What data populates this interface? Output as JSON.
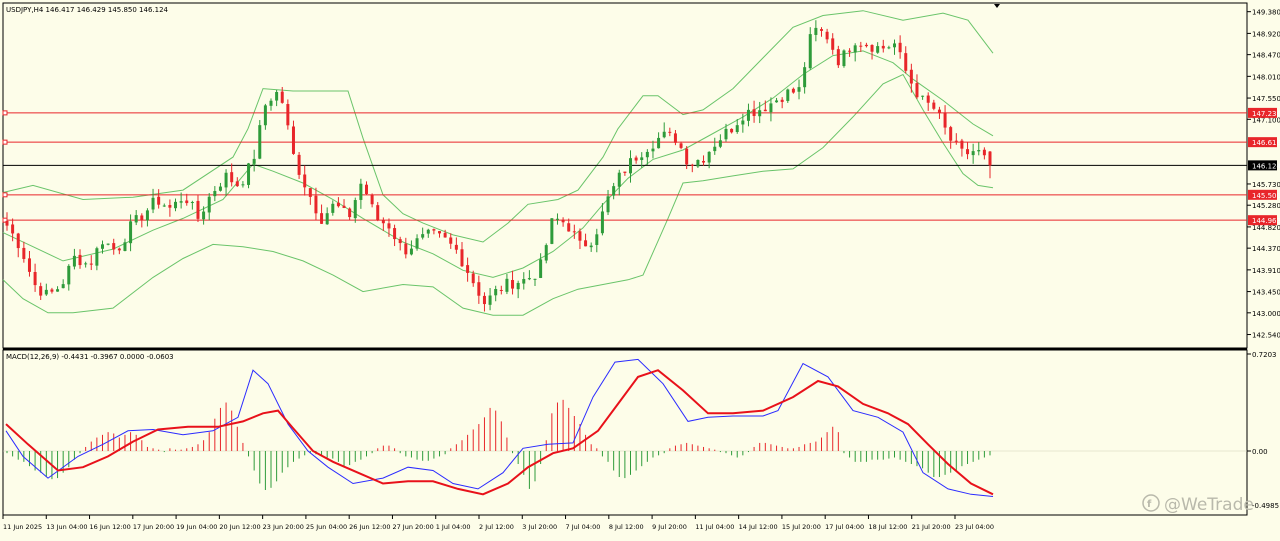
{
  "header": {
    "price_info": "USDJPY,H4  146.417 146.429 145.850 146.124"
  },
  "macd": {
    "header": "MACD(12,26,9) -0.4431 -0.3967 0.0000 -0.0603"
  },
  "price_axis": {
    "ticks": [
      "149.380",
      "148.920",
      "148.470",
      "148.010",
      "147.550",
      "147.100",
      "145.730",
      "145.280",
      "144.820",
      "144.370",
      "143.910",
      "143.450",
      "143.000",
      "142.540"
    ]
  },
  "macd_axis": {
    "ticks": [
      "0.7203",
      "0.00",
      "-0.4985"
    ]
  },
  "levels": [
    {
      "label": "147.236",
      "value": 147.236
    },
    {
      "label": "146.616",
      "value": 146.616
    },
    {
      "label": "145.500",
      "value": 145.5
    },
    {
      "label": "144.963",
      "value": 144.963
    }
  ],
  "current_price": {
    "label": "146.124",
    "value": 146.124
  },
  "time_axis": {
    "labels": [
      "11 Jun 2025",
      "13 Jun 04:00",
      "16 Jun 12:00",
      "17 Jun 20:00",
      "19 Jun 04:00",
      "20 Jun 12:00",
      "23 Jun 20:00",
      "25 Jun 04:00",
      "26 Jun 12:00",
      "27 Jun 20:00",
      "1 Jul 04:00",
      "2 Jul 12:00",
      "3 Jul 20:00",
      "7 Jul 04:00",
      "8 Jul 12:00",
      "9 Jul 20:00",
      "11 Jul 04:00",
      "14 Jul 12:00",
      "15 Jul 20:00",
      "17 Jul 04:00",
      "18 Jul 12:00",
      "21 Jul 20:00",
      "23 Jul 04:00"
    ]
  },
  "watermark": "@WeTrade",
  "colors": {
    "background": "#fdfde9",
    "bull": "#2e9b3a",
    "bear": "#e8262a",
    "bands": "#6ac46a",
    "level_line": "#e8262a",
    "macd_line": "#2b2bff",
    "signal_line": "#e8111a"
  },
  "chart_data": {
    "type": "candlestick",
    "symbol": "USDJPY",
    "timeframe": "H4",
    "ohlc_last": {
      "open": 146.417,
      "high": 146.429,
      "low": 145.85,
      "close": 146.124
    },
    "ylim": [
      142.54,
      149.38
    ],
    "close_path": [
      144.85,
      144.4,
      143.6,
      143.35,
      143.6,
      144.2,
      144.0,
      144.55,
      144.3,
      144.8,
      145.1,
      145.4,
      145.2,
      145.5,
      145.0,
      145.55,
      145.9,
      145.7,
      146.2,
      147.5,
      147.7,
      146.3,
      145.6,
      145.0,
      145.3,
      145.0,
      145.8,
      145.0,
      144.85,
      144.3,
      144.5,
      144.65,
      144.55,
      144.3,
      143.75,
      143.2,
      143.5,
      143.65,
      143.7,
      143.9,
      145.0,
      144.9,
      144.4,
      144.6,
      145.4,
      145.95,
      146.3,
      146.55,
      146.75,
      146.7,
      146.15,
      146.3,
      146.65,
      146.9,
      147.25,
      147.3,
      147.45,
      147.65,
      147.7,
      149.0,
      148.9,
      148.3,
      148.8,
      148.7,
      148.6,
      148.7,
      148.0,
      147.5,
      147.3,
      146.7,
      146.35,
      146.45,
      146.124
    ],
    "bollinger": {
      "upper": [
        [
          0,
          145.55
        ],
        [
          30,
          145.7
        ],
        [
          80,
          145.4
        ],
        [
          130,
          145.45
        ],
        [
          180,
          145.6
        ],
        [
          230,
          146.3
        ],
        [
          245,
          146.9
        ],
        [
          260,
          147.75
        ],
        [
          290,
          147.7
        ],
        [
          345,
          147.7
        ],
        [
          360,
          146.7
        ],
        [
          380,
          145.5
        ],
        [
          400,
          145.1
        ],
        [
          420,
          144.9
        ],
        [
          450,
          144.65
        ],
        [
          480,
          144.5
        ],
        [
          505,
          144.9
        ],
        [
          525,
          145.3
        ],
        [
          555,
          145.4
        ],
        [
          575,
          145.6
        ],
        [
          600,
          146.3
        ],
        [
          615,
          146.9
        ],
        [
          640,
          147.6
        ],
        [
          655,
          147.6
        ],
        [
          680,
          147.2
        ],
        [
          700,
          147.3
        ],
        [
          730,
          147.75
        ],
        [
          760,
          148.4
        ],
        [
          790,
          149.05
        ],
        [
          820,
          149.3
        ],
        [
          860,
          149.4
        ],
        [
          900,
          149.2
        ],
        [
          940,
          149.35
        ],
        [
          965,
          149.2
        ],
        [
          990,
          148.5
        ]
      ],
      "lower": [
        [
          0,
          143.7
        ],
        [
          20,
          143.3
        ],
        [
          45,
          143.0
        ],
        [
          70,
          143.0
        ],
        [
          110,
          143.1
        ],
        [
          150,
          143.75
        ],
        [
          180,
          144.15
        ],
        [
          210,
          144.45
        ],
        [
          240,
          144.4
        ],
        [
          270,
          144.3
        ],
        [
          300,
          144.1
        ],
        [
          330,
          143.8
        ],
        [
          360,
          143.45
        ],
        [
          400,
          143.6
        ],
        [
          430,
          143.55
        ],
        [
          460,
          143.1
        ],
        [
          490,
          142.95
        ],
        [
          520,
          142.95
        ],
        [
          550,
          143.3
        ],
        [
          575,
          143.5
        ],
        [
          600,
          143.6
        ],
        [
          625,
          143.7
        ],
        [
          640,
          143.8
        ],
        [
          665,
          145.0
        ],
        [
          680,
          145.75
        ],
        [
          700,
          145.8
        ],
        [
          730,
          145.9
        ],
        [
          760,
          146.0
        ],
        [
          790,
          146.05
        ],
        [
          820,
          146.5
        ],
        [
          850,
          147.15
        ],
        [
          880,
          147.85
        ],
        [
          900,
          148.05
        ],
        [
          920,
          147.3
        ],
        [
          940,
          146.6
        ],
        [
          960,
          145.95
        ],
        [
          975,
          145.7
        ],
        [
          990,
          145.65
        ]
      ],
      "middle": [
        [
          0,
          144.7
        ],
        [
          30,
          144.4
        ],
        [
          60,
          144.1
        ],
        [
          110,
          144.35
        ],
        [
          150,
          144.75
        ],
        [
          180,
          145.0
        ],
        [
          220,
          145.4
        ],
        [
          250,
          146.15
        ],
        [
          270,
          146.0
        ],
        [
          300,
          145.75
        ],
        [
          330,
          145.4
        ],
        [
          360,
          145.0
        ],
        [
          400,
          144.5
        ],
        [
          430,
          144.25
        ],
        [
          460,
          143.9
        ],
        [
          490,
          143.75
        ],
        [
          520,
          143.95
        ],
        [
          550,
          144.3
        ],
        [
          580,
          144.8
        ],
        [
          600,
          145.3
        ],
        [
          625,
          145.85
        ],
        [
          650,
          146.25
        ],
        [
          680,
          146.45
        ],
        [
          710,
          146.8
        ],
        [
          740,
          147.15
        ],
        [
          770,
          147.55
        ],
        [
          800,
          148.05
        ],
        [
          830,
          148.45
        ],
        [
          860,
          148.55
        ],
        [
          890,
          148.3
        ],
        [
          910,
          147.95
        ],
        [
          940,
          147.5
        ],
        [
          970,
          147.0
        ],
        [
          990,
          146.75
        ]
      ]
    },
    "macd": {
      "ylim": [
        -0.4985,
        0.7203
      ],
      "macd_line": [
        [
          3,
          0.15
        ],
        [
          20,
          -0.05
        ],
        [
          45,
          -0.25
        ],
        [
          75,
          -0.05
        ],
        [
          100,
          0.05
        ],
        [
          125,
          0.15
        ],
        [
          150,
          0.16
        ],
        [
          180,
          0.12
        ],
        [
          210,
          0.15
        ],
        [
          235,
          0.25
        ],
        [
          250,
          0.6
        ],
        [
          265,
          0.5
        ],
        [
          285,
          0.2
        ],
        [
          305,
          0.0
        ],
        [
          325,
          -0.15
        ],
        [
          350,
          -0.3
        ],
        [
          380,
          -0.25
        ],
        [
          405,
          -0.15
        ],
        [
          430,
          -0.18
        ],
        [
          450,
          -0.3
        ],
        [
          475,
          -0.35
        ],
        [
          500,
          -0.2
        ],
        [
          520,
          0.02
        ],
        [
          545,
          0.05
        ],
        [
          570,
          0.06
        ],
        [
          590,
          0.4
        ],
        [
          612,
          0.66
        ],
        [
          635,
          0.68
        ],
        [
          660,
          0.5
        ],
        [
          685,
          0.22
        ],
        [
          705,
          0.25
        ],
        [
          730,
          0.26
        ],
        [
          760,
          0.26
        ],
        [
          775,
          0.3
        ],
        [
          800,
          0.65
        ],
        [
          825,
          0.55
        ],
        [
          850,
          0.3
        ],
        [
          875,
          0.25
        ],
        [
          900,
          0.14
        ],
        [
          920,
          -0.2
        ],
        [
          945,
          -0.35
        ],
        [
          968,
          -0.4
        ],
        [
          990,
          -0.42
        ]
      ],
      "signal_line": [
        [
          3,
          0.2
        ],
        [
          25,
          0.05
        ],
        [
          55,
          -0.18
        ],
        [
          80,
          -0.15
        ],
        [
          105,
          -0.05
        ],
        [
          130,
          0.07
        ],
        [
          155,
          0.16
        ],
        [
          185,
          0.18
        ],
        [
          215,
          0.18
        ],
        [
          240,
          0.22
        ],
        [
          260,
          0.28
        ],
        [
          275,
          0.3
        ],
        [
          290,
          0.17
        ],
        [
          310,
          0.0
        ],
        [
          330,
          -0.1
        ],
        [
          355,
          -0.2
        ],
        [
          380,
          -0.3
        ],
        [
          405,
          -0.28
        ],
        [
          430,
          -0.28
        ],
        [
          455,
          -0.35
        ],
        [
          480,
          -0.4
        ],
        [
          505,
          -0.3
        ],
        [
          525,
          -0.15
        ],
        [
          550,
          -0.02
        ],
        [
          570,
          0.02
        ],
        [
          595,
          0.15
        ],
        [
          615,
          0.35
        ],
        [
          635,
          0.55
        ],
        [
          655,
          0.6
        ],
        [
          680,
          0.45
        ],
        [
          705,
          0.28
        ],
        [
          730,
          0.28
        ],
        [
          760,
          0.3
        ],
        [
          790,
          0.4
        ],
        [
          815,
          0.52
        ],
        [
          835,
          0.48
        ],
        [
          860,
          0.35
        ],
        [
          885,
          0.28
        ],
        [
          905,
          0.2
        ],
        [
          925,
          0.05
        ],
        [
          945,
          -0.12
        ],
        [
          968,
          -0.3
        ],
        [
          990,
          -0.4
        ]
      ],
      "histogram": [
        -0.02,
        -0.05,
        -0.08,
        -0.1,
        -0.14,
        -0.18,
        -0.2,
        -0.24,
        -0.26,
        -0.25,
        -0.2,
        -0.15,
        -0.08,
        -0.02,
        0.03,
        0.07,
        0.1,
        0.12,
        0.14,
        0.13,
        0.1,
        0.12,
        0.14,
        0.12,
        0.08,
        0.03,
        0.02,
        0.01,
        -0.01,
        0.02,
        0.01,
        0.01,
        0.02,
        0.03,
        0.05,
        0.08,
        0.14,
        0.24,
        0.32,
        0.36,
        0.3,
        0.18,
        0.06,
        -0.05,
        -0.18,
        -0.3,
        -0.36,
        -0.34,
        -0.28,
        -0.2,
        -0.15,
        -0.1,
        -0.07,
        -0.04,
        -0.02,
        -0.03,
        -0.05,
        -0.06,
        -0.07,
        -0.1,
        -0.14,
        -0.13,
        -0.1,
        -0.08,
        -0.05,
        -0.02,
        0.02,
        0.04,
        0.04,
        0.02,
        -0.02,
        -0.05,
        -0.06,
        -0.08,
        -0.09,
        -0.09,
        -0.07,
        -0.05,
        -0.03,
        0.02,
        0.05,
        0.08,
        0.12,
        0.16,
        0.2,
        0.25,
        0.32,
        0.3,
        0.22,
        0.1,
        -0.02,
        -0.12,
        -0.22,
        -0.35,
        -0.28,
        -0.12,
        0.08,
        0.28,
        0.36,
        0.38,
        0.32,
        0.26,
        0.2,
        0.12,
        0.05,
        0.02,
        -0.05,
        -0.1,
        -0.18,
        -0.24,
        -0.25,
        -0.22,
        -0.18,
        -0.14,
        -0.1,
        -0.06,
        -0.04,
        -0.02,
        0.02,
        0.04,
        0.05,
        0.06,
        0.05,
        0.04,
        0.03,
        0.02,
        0.01,
        -0.01,
        -0.02,
        -0.04,
        -0.06,
        -0.04,
        -0.01,
        0.03,
        0.06,
        0.06,
        0.05,
        0.04,
        0.03,
        0.02,
        0.02,
        0.03,
        0.05,
        0.06,
        0.07,
        0.1,
        0.14,
        0.18,
        0.14,
        -0.02,
        -0.06,
        -0.1,
        -0.1,
        -0.1,
        -0.08,
        -0.08,
        -0.08,
        -0.07,
        -0.06,
        -0.08,
        -0.1,
        -0.12,
        -0.14,
        -0.16,
        -0.2,
        -0.24,
        -0.24,
        -0.22,
        -0.2,
        -0.18,
        -0.14,
        -0.12,
        -0.1,
        -0.08,
        -0.06,
        -0.04
      ]
    }
  }
}
